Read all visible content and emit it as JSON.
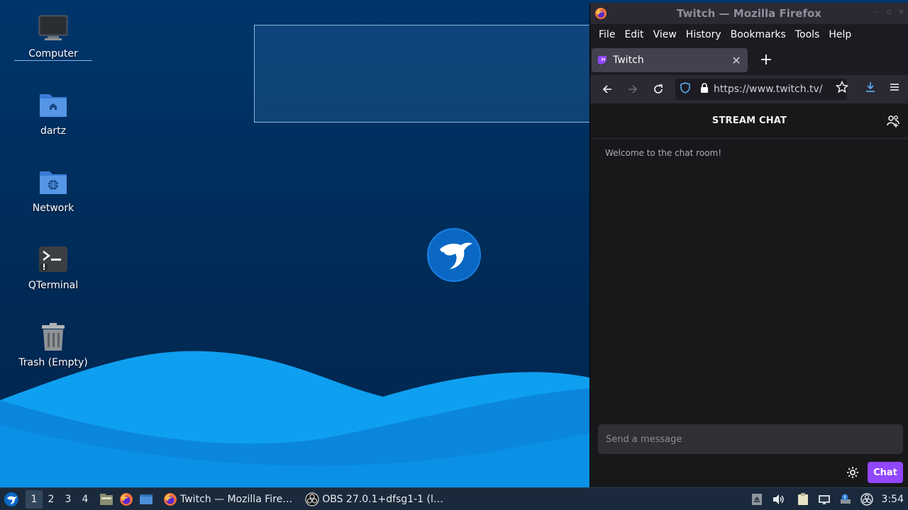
{
  "desktop": {
    "icons": [
      {
        "label": "Computer",
        "icon": "computer-icon"
      },
      {
        "label": "dartz",
        "icon": "home-folder-icon"
      },
      {
        "label": "Network",
        "icon": "network-folder-icon"
      },
      {
        "label": "QTerminal",
        "icon": "terminal-icon"
      },
      {
        "label": "Trash (Empty)",
        "icon": "trash-icon"
      }
    ]
  },
  "firefox": {
    "window_title": "Twitch — Mozilla Firefox",
    "menu": [
      "File",
      "Edit",
      "View",
      "History",
      "Bookmarks",
      "Tools",
      "Help"
    ],
    "tab": {
      "title": "Twitch"
    },
    "url": "https://www.twitch.tv/",
    "page": {
      "header_title": "STREAM CHAT",
      "welcome": "Welcome to the chat room!",
      "input_placeholder": "Send a message",
      "chat_button": "Chat"
    },
    "accent": "#9147ff"
  },
  "taskbar": {
    "workspaces": [
      "1",
      "2",
      "3",
      "4"
    ],
    "active_workspace": "1",
    "tasks": [
      {
        "label": "Twitch — Mozilla Fire…",
        "icon": "firefox-icon"
      },
      {
        "label": "OBS 27.0.1+dfsg1-1 (l…",
        "icon": "obs-icon"
      }
    ],
    "clock": "3:54"
  }
}
